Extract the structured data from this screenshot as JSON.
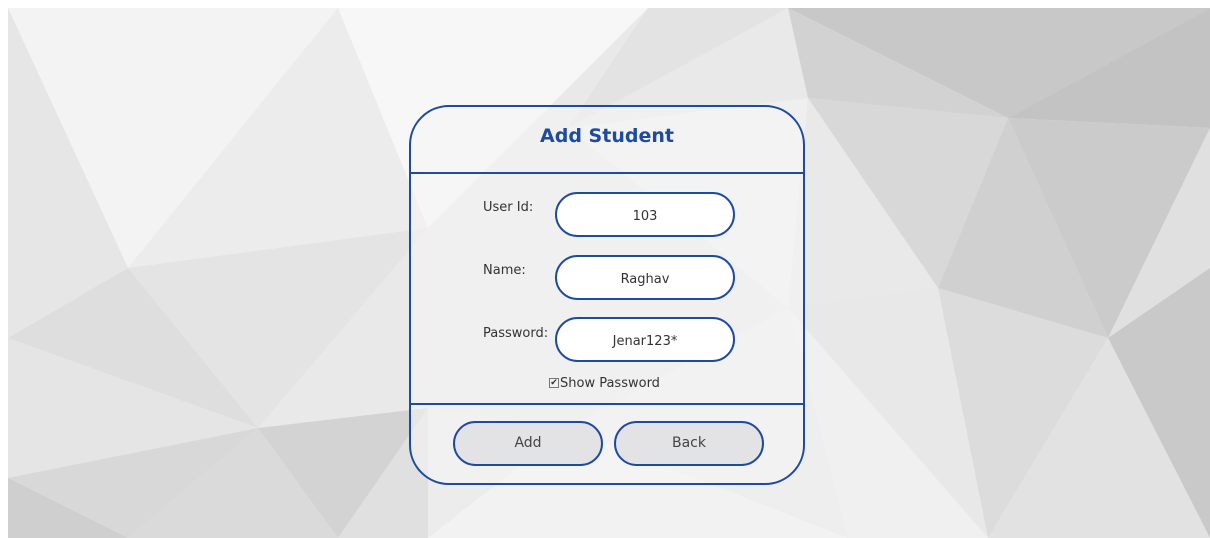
{
  "form": {
    "title": "Add Student",
    "fields": [
      {
        "label": "User Id:",
        "value": "103"
      },
      {
        "label": "Name:",
        "value": "Raghav"
      },
      {
        "label": "Password:",
        "value": "Jenar123*"
      }
    ],
    "show_password": {
      "label": "Show Password",
      "checked": true,
      "mark": "✔"
    },
    "buttons": {
      "add": "Add",
      "back": "Back"
    }
  },
  "colors": {
    "accent": "#1e4aa0",
    "background": "#e9e9e9",
    "button_fill": "#e3e3e5"
  }
}
